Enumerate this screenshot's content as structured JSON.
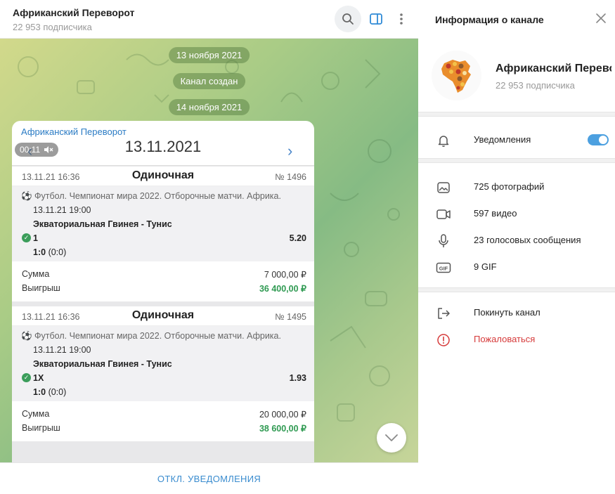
{
  "header": {
    "title": "Африканский Переворот",
    "subscribers": "22 953 подписчика"
  },
  "chat": {
    "date_pills": [
      "13 ноября 2021",
      "Канал создан",
      "14 ноября 2021"
    ],
    "message": {
      "author": "Африканский Переворот",
      "video": {
        "duration": "00:11"
      },
      "screenshot_date": "13.11.2021",
      "bets": [
        {
          "datetime": "13.11.21 16:36",
          "type": "Одиночная",
          "number": "№ 1496",
          "league": "⚽ Футбол. Чемпионат мира 2022. Отборочные матчи. Африка.",
          "match_time": "13.11.21 19:00",
          "teams": "Экваториальная Гвинея - Тунис",
          "pick": "1",
          "odds": "5.20",
          "score_main": "1:0",
          "score_half": "(0:0)",
          "sum_label": "Сумма",
          "sum_value": "7 000,00 ₽",
          "win_label": "Выигрыш",
          "win_value": "36 400,00 ₽"
        },
        {
          "datetime": "13.11.21 16:36",
          "type": "Одиночная",
          "number": "№ 1495",
          "league": "⚽ Футбол. Чемпионат мира 2022. Отборочные матчи. Африка.",
          "match_time": "13.11.21 19:00",
          "teams": "Экваториальная Гвинея - Тунис",
          "pick": "1X",
          "odds": "1.93",
          "score_main": "1:0",
          "score_half": "(0:0)",
          "sum_label": "Сумма",
          "sum_value": "20 000,00 ₽",
          "win_label": "Выигрыш",
          "win_value": "38 600,00 ₽"
        }
      ]
    },
    "mute_button": "ОТКЛ. УВЕДОМЛЕНИЯ"
  },
  "info": {
    "title": "Информация о канале",
    "channel_name": "Африканский Переворот",
    "subscribers": "22 953 подписчика",
    "notifications_label": "Уведомления",
    "notifications_on": true,
    "media": [
      {
        "icon": "photo-icon",
        "label": "725 фотографий"
      },
      {
        "icon": "video-icon",
        "label": "597 видео"
      },
      {
        "icon": "microphone-icon",
        "label": "23 голосовых сообщения"
      },
      {
        "icon": "gif-icon",
        "label": "9 GIF"
      }
    ],
    "actions": [
      {
        "icon": "leave-icon",
        "label": "Покинуть канал"
      },
      {
        "icon": "report-icon",
        "label": "Пожаловаться"
      }
    ]
  },
  "colors": {
    "accent": "#4ca0e0",
    "link": "#2a7bc4",
    "win": "#2f9a52",
    "danger": "#d63a3a"
  }
}
